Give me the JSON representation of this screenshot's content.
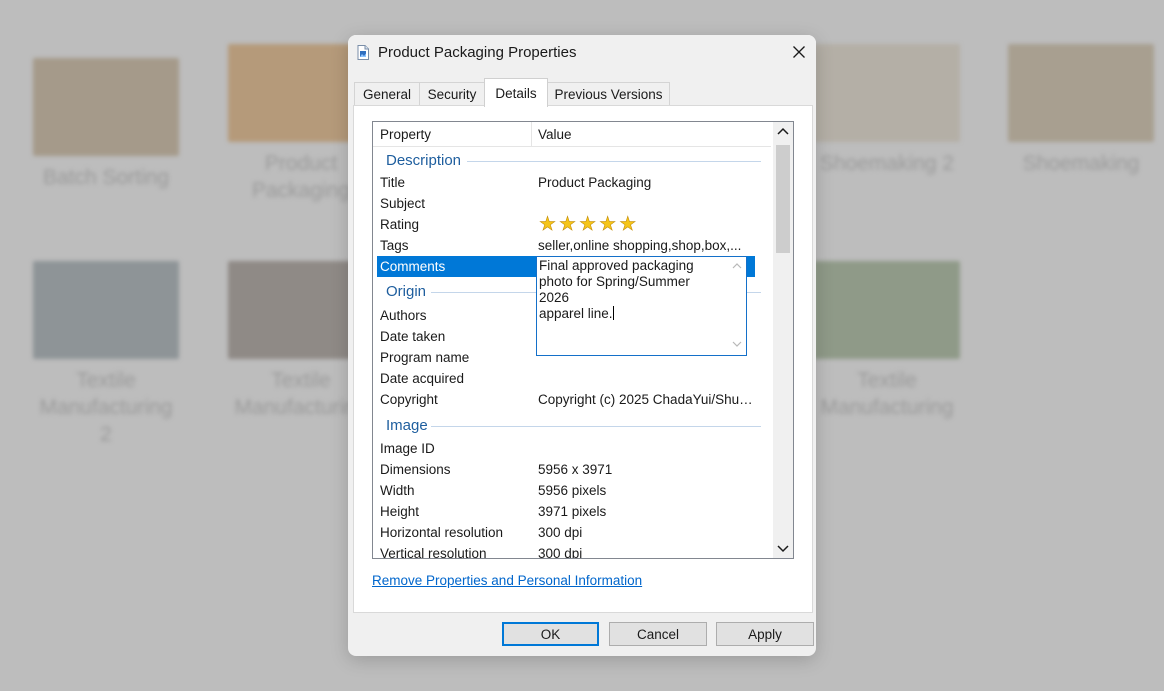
{
  "background": {
    "items": [
      {
        "label": "Batch Sorting",
        "thumb": "#a59a8a"
      },
      {
        "label": "Product\nPackaging",
        "thumb": "#b59a7a"
      },
      {
        "label": "",
        "thumb": "#b0a89a"
      },
      {
        "label": "",
        "thumb": "#a8a8a8"
      },
      {
        "label": "Shoemaking 2",
        "thumb": "#b4afa6"
      },
      {
        "label": "Shoemaking",
        "thumb": "#a89f90"
      },
      {
        "label": "Textile\nManufacturing 2",
        "thumb": "#8e9497"
      },
      {
        "label": "Textile\nManufacturing",
        "thumb": "#8f8a86"
      },
      {
        "label": "",
        "thumb": "#9a9a9a"
      },
      {
        "label": "",
        "thumb": "#a0a0a0"
      },
      {
        "label": "",
        "thumb": "#8a9a86"
      },
      {
        "label": "Textile\nManufacturing",
        "thumb": "#8f9a88"
      }
    ]
  },
  "dialog": {
    "title": "Product Packaging Properties",
    "tabs": [
      "General",
      "Security",
      "Details",
      "Previous Versions"
    ],
    "active_tab": "Details",
    "columns": {
      "property": "Property",
      "value": "Value"
    },
    "groups": {
      "description": {
        "label": "Description",
        "rows": [
          {
            "name": "Title",
            "value": "Product Packaging"
          },
          {
            "name": "Subject",
            "value": ""
          },
          {
            "name": "Rating",
            "value": "",
            "stars": 5
          },
          {
            "name": "Tags",
            "value": "seller,online shopping,shop,box,..."
          },
          {
            "name": "Comments",
            "value": "Final approved packaging\nphoto for Spring/Summer 2026\napparel line."
          }
        ]
      },
      "origin": {
        "label": "Origin",
        "rows": [
          {
            "name": "Authors",
            "value": ""
          },
          {
            "name": "Date taken",
            "value": ""
          },
          {
            "name": "Program name",
            "value": ""
          },
          {
            "name": "Date acquired",
            "value": ""
          },
          {
            "name": "Copyright",
            "value": "Copyright (c) 2025 ChadaYui/Shut..."
          }
        ]
      },
      "image": {
        "label": "Image",
        "rows": [
          {
            "name": "Image ID",
            "value": ""
          },
          {
            "name": "Dimensions",
            "value": "5956 x 3971"
          },
          {
            "name": "Width",
            "value": "5956 pixels"
          },
          {
            "name": "Height",
            "value": "3971 pixels"
          },
          {
            "name": "Horizontal resolution",
            "value": "300 dpi"
          },
          {
            "name": "Vertical resolution",
            "value": "300 dpi"
          }
        ]
      }
    },
    "link": "Remove Properties and Personal Information",
    "buttons": {
      "ok": "OK",
      "cancel": "Cancel",
      "apply": "Apply"
    },
    "colors": {
      "selection": "#0078d7",
      "group_header": "#1e5e9e",
      "link": "#0066cc",
      "star": "#f5c518"
    }
  }
}
